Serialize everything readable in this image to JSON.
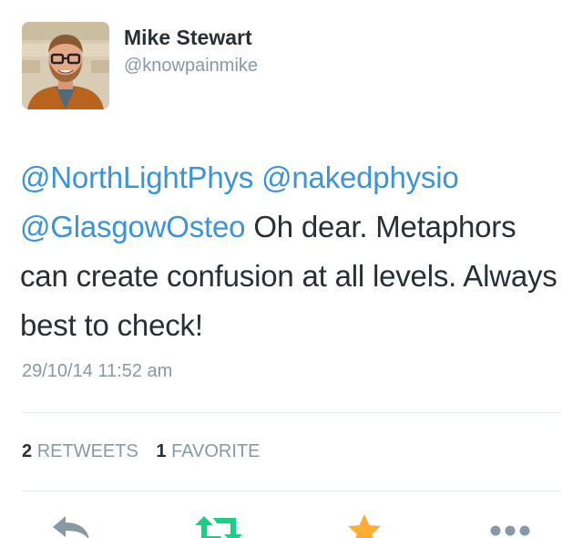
{
  "user": {
    "name": "Mike Stewart",
    "handle": "@knowpainmike"
  },
  "tweet": {
    "mentions": [
      "@NorthLightPhys",
      "@nakedphysio",
      "@GlasgowOsteo"
    ],
    "text": "Oh dear. Metaphors can create confusion at all levels. Always best to check!",
    "timestamp": "29/10/14 11:52 am"
  },
  "stats": {
    "retweets_count": "2",
    "retweets_label": "RETWEETS",
    "favorites_count": "1",
    "favorites_label": "FAVORITE"
  },
  "actions": {
    "reply_icon": "reply-icon",
    "retweet_icon": "retweet-icon",
    "favorite_icon": "star-icon",
    "more_icon": "ellipsis-icon",
    "retweet_color": "#19cf86",
    "favorite_color": "#ffac33",
    "neutral_color": "#8899a6"
  },
  "colors": {
    "mention": "#3b94d9",
    "text": "#292f33",
    "muted": "#8899a6"
  }
}
